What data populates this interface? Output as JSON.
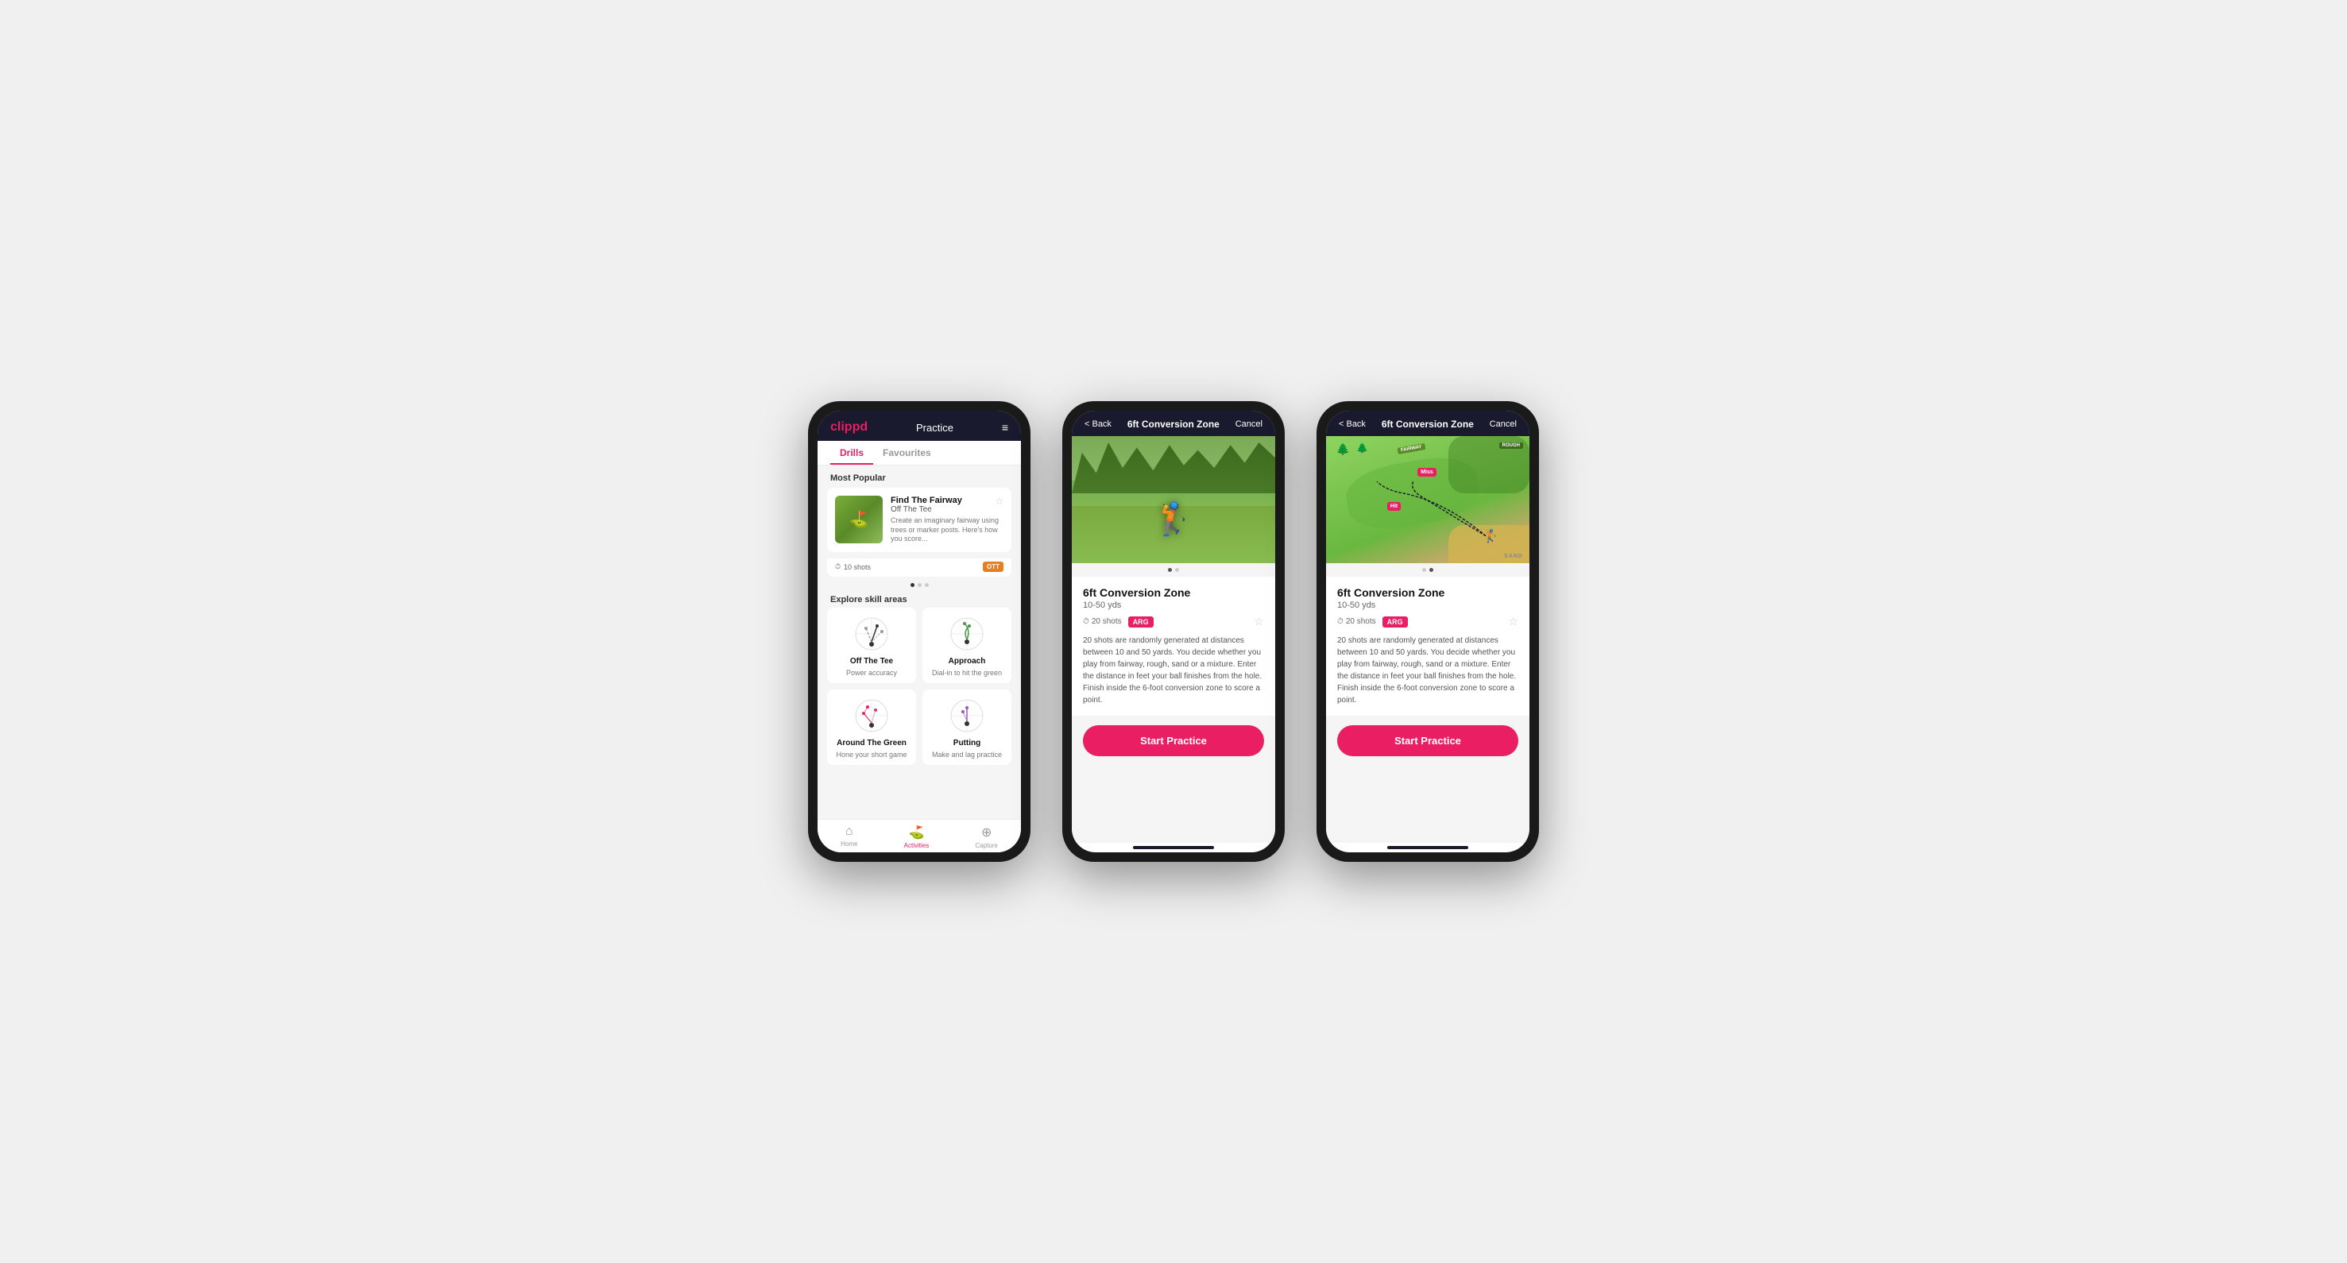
{
  "phone1": {
    "header": {
      "logo": "clippd",
      "title": "Practice",
      "menu_icon": "≡"
    },
    "tabs": [
      {
        "label": "Drills",
        "active": true
      },
      {
        "label": "Favourites",
        "active": false
      }
    ],
    "most_popular": {
      "section_title": "Most Popular",
      "card": {
        "title": "Find The Fairway",
        "subtitle": "Off The Tee",
        "description": "Create an imaginary fairway using trees or marker posts. Here's how you score...",
        "shots": "10 shots",
        "tag": "OTT",
        "star": "☆"
      },
      "dots": [
        true,
        false,
        false
      ]
    },
    "explore": {
      "section_title": "Explore skill areas",
      "items": [
        {
          "label": "Off The Tee",
          "sublabel": "Power accuracy",
          "icon": "ott"
        },
        {
          "label": "Approach",
          "sublabel": "Dial-in to hit the green",
          "icon": "approach"
        },
        {
          "label": "Around The Green",
          "sublabel": "Hone your short game",
          "icon": "atg"
        },
        {
          "label": "Putting",
          "sublabel": "Make and lag practice",
          "icon": "putting"
        }
      ]
    },
    "bottom_nav": [
      {
        "label": "Home",
        "icon": "⌂",
        "active": false
      },
      {
        "label": "Activities",
        "icon": "⛳",
        "active": true
      },
      {
        "label": "Capture",
        "icon": "+",
        "active": false
      }
    ]
  },
  "phone2": {
    "header": {
      "back_label": "< Back",
      "title": "6ft Conversion Zone",
      "cancel_label": "Cancel"
    },
    "image_dots": [
      true,
      false
    ],
    "drill": {
      "title": "6ft Conversion Zone",
      "range": "10-50 yds",
      "shots": "20 shots",
      "tag": "ARG",
      "star": "☆",
      "description": "20 shots are randomly generated at distances between 10 and 50 yards. You decide whether you play from fairway, rough, sand or a mixture. Enter the distance in feet your ball finishes from the hole. Finish inside the 6-foot conversion zone to score a point."
    },
    "start_button": "Start Practice"
  },
  "phone3": {
    "header": {
      "back_label": "< Back",
      "title": "6ft Conversion Zone",
      "cancel_label": "Cancel"
    },
    "image_dots": [
      false,
      true
    ],
    "drill": {
      "title": "6ft Conversion Zone",
      "range": "10-50 yds",
      "shots": "20 shots",
      "tag": "ARG",
      "star": "☆",
      "description": "20 shots are randomly generated at distances between 10 and 50 yards. You decide whether you play from fairway, rough, sand or a mixture. Enter the distance in feet your ball finishes from the hole. Finish inside the 6-foot conversion zone to score a point."
    },
    "map_labels": {
      "fairway": "FAIRWAY",
      "rough": "ROUGH",
      "sand": "SAND",
      "hit": "Hit",
      "miss": "Miss"
    },
    "start_button": "Start Practice"
  }
}
